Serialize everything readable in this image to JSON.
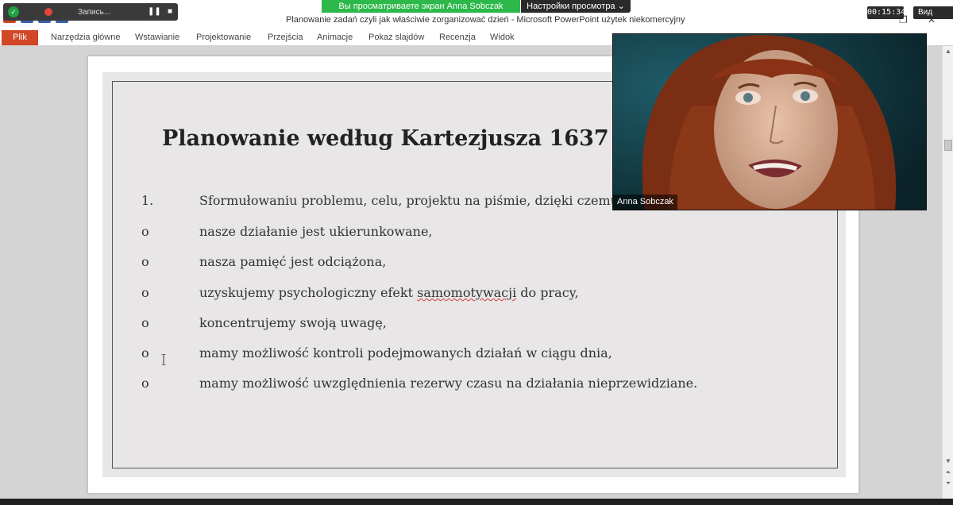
{
  "zoom": {
    "recording_label": "Запись...",
    "share_banner": "Вы просматриваете экран Anna Sobczak",
    "view_options": "Настройки просмотра",
    "view_options_chevron": "⌄",
    "timer": "00:15:34",
    "view_button": "Вид",
    "pause_glyph": "❚❚",
    "stop_glyph": "■",
    "shield_glyph": "✓",
    "speaker_name": "Anna Sobczak"
  },
  "window": {
    "title": "Planowanie zadań czyli jak właściwie zorganizować dzień  -  Microsoft PowerPoint użytek niekomercyjny",
    "restore_glyph": "❐",
    "close_glyph": "✕",
    "ribbon_expand_glyph": "⌄",
    "help_glyph": "?"
  },
  "ribbon": {
    "file": "Plik",
    "tabs": [
      "Narzędzia główne",
      "Wstawianie",
      "Projektowanie",
      "Przejścia",
      "Animacje",
      "Pokaz slajdów",
      "Recenzja",
      "Widok"
    ]
  },
  "slide": {
    "title": "Planowanie według Kartezjusza 1637",
    "items": [
      {
        "marker": "1.",
        "text": "Sformułowaniu problemu, celu, projektu na piśmie, dzięki czemu:"
      },
      {
        "marker": "o",
        "text": "nasze działanie jest ukierunkowane,"
      },
      {
        "marker": "o",
        "text": "nasza pamięć jest odciążona,"
      },
      {
        "marker": "o",
        "text_pre": "uzyskujemy psychologiczny efekt ",
        "text_flag": "samomotywacji",
        "text_post": " do pracy,"
      },
      {
        "marker": "o",
        "text": "koncentrujemy swoją uwagę,"
      },
      {
        "marker": "o",
        "text": "mamy możliwość kontroli podejmowanych działań w ciągu dnia,"
      },
      {
        "marker": "o",
        "text": "mamy możliwość uwzględnienia rezerwy czasu na działania nieprzewidziane."
      }
    ]
  },
  "scrollbar": {
    "up_glyph": "▲",
    "down_glyph": "▼",
    "prev_glyph": "⏶",
    "next_glyph": "⏷"
  },
  "colors": {
    "share_banner": "#2db84a",
    "file_tab": "#d24726",
    "recording_dot": "#e0473a"
  }
}
